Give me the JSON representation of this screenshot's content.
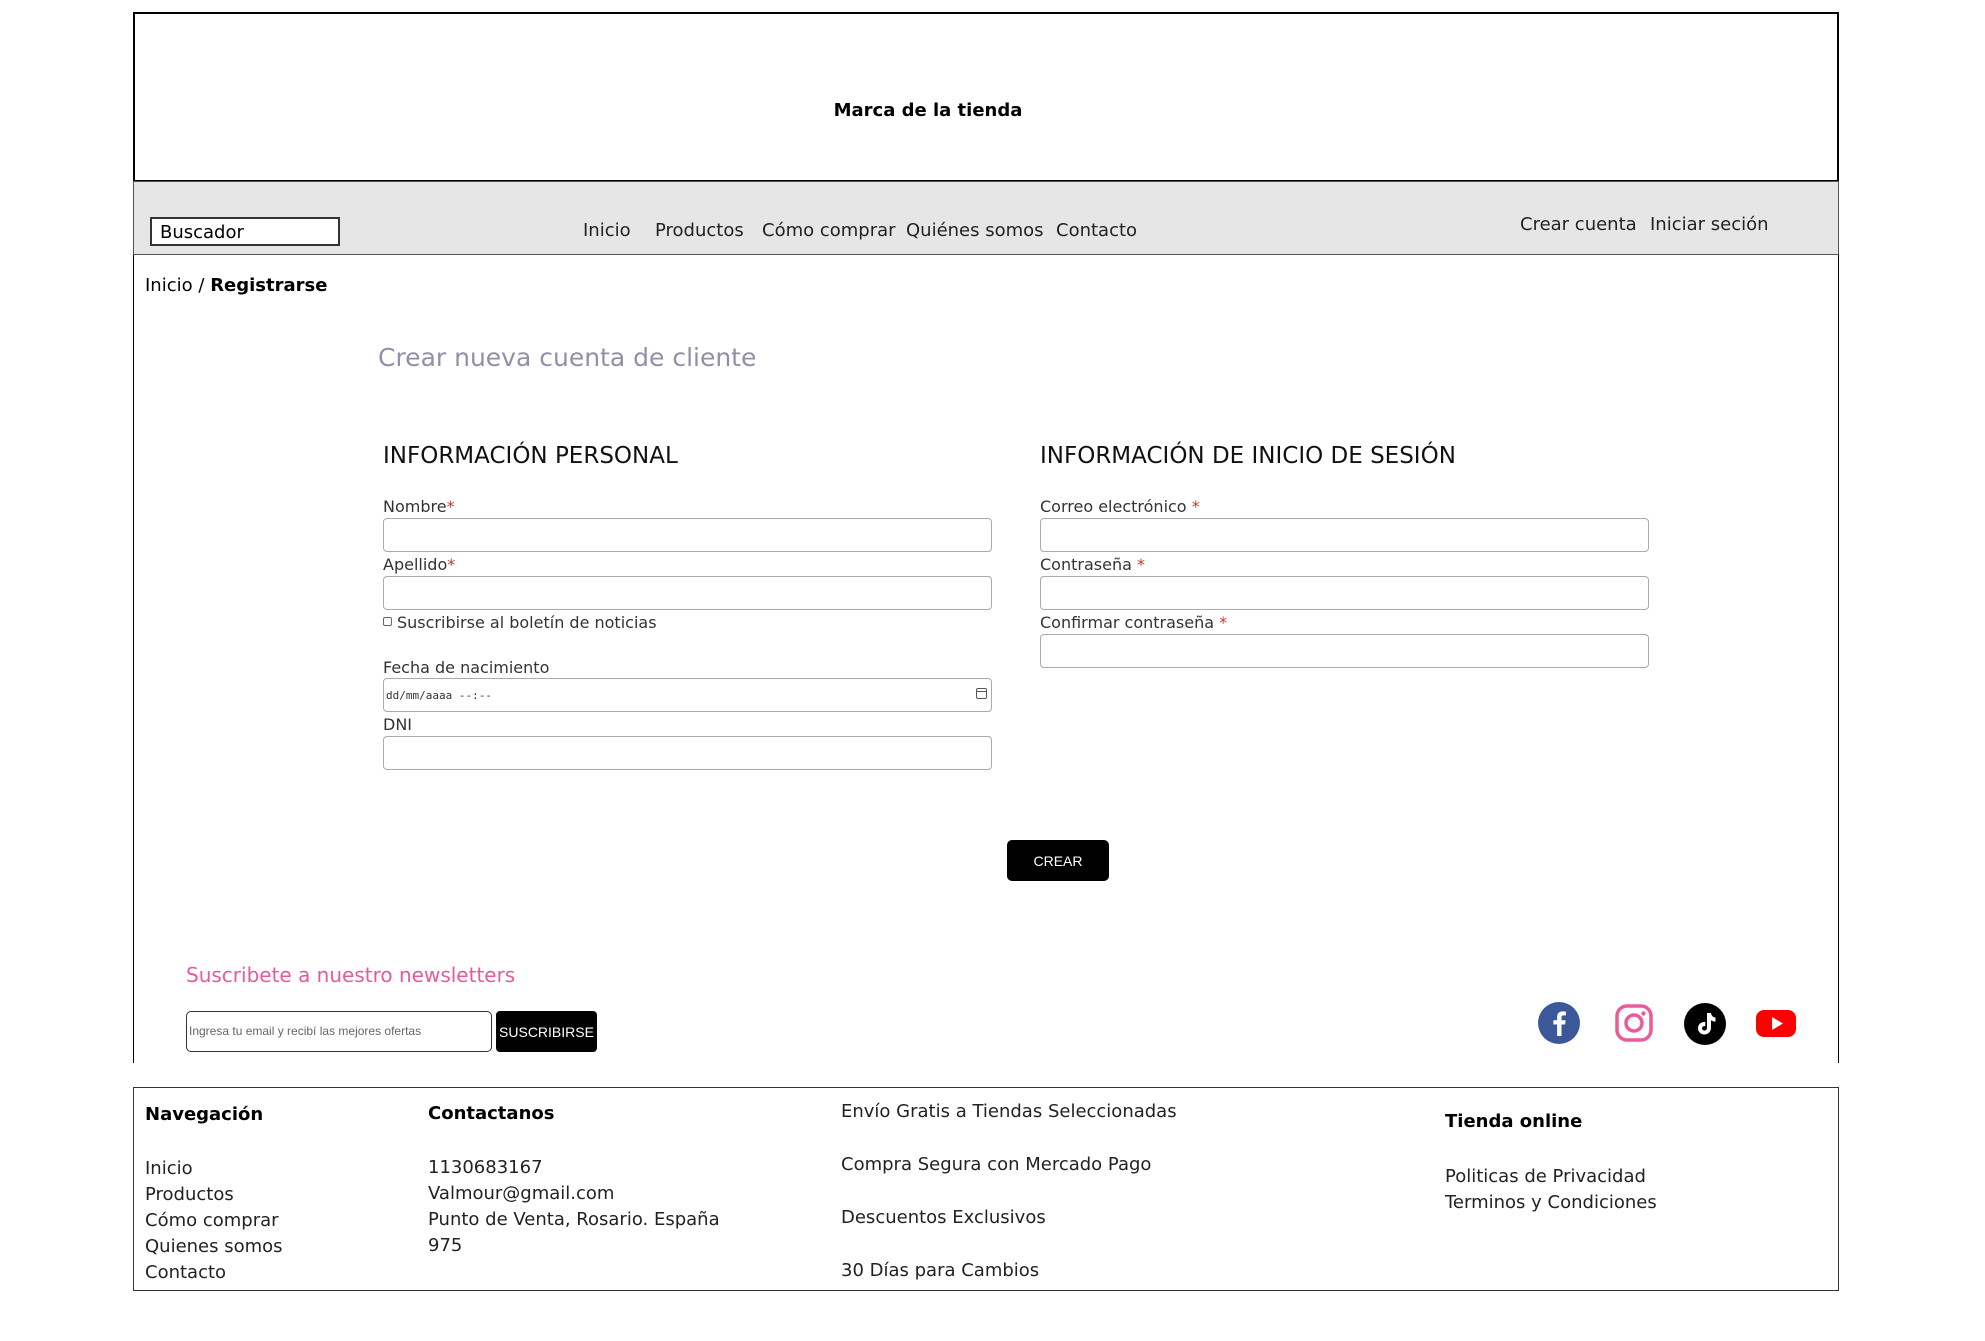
{
  "header": {
    "brand": "Marca de la tienda"
  },
  "navbar": {
    "search_placeholder": "Buscador",
    "links": [
      "Inicio",
      "Productos",
      "Cómo comprar",
      "Quiénes somos",
      "Contacto"
    ],
    "create_account": "Crear cuenta",
    "login": "Iniciar seción"
  },
  "breadcrumb": {
    "home": "Inicio",
    "separator": "/",
    "current": "Registrarse"
  },
  "form": {
    "title": "Crear nueva cuenta de cliente",
    "personal": {
      "heading": "INFORMACIÓN PERSONAL",
      "nombre": "Nombre",
      "apellido": "Apellido",
      "newsletter": "Suscribirse al boletín de noticias",
      "birthdate": "Fecha de nacimiento",
      "birthdate_placeholder": "dd/mm/aaaa --:--",
      "dni": "DNI"
    },
    "login": {
      "heading": "INFORMACIÓN DE INICIO DE SESIÓN",
      "email": "Correo electrónico",
      "password": "Contraseña",
      "confirm": "Confirmar contraseña"
    },
    "required_mark": "*",
    "submit": "CREAR"
  },
  "newsletter": {
    "title": "Suscribete a nuestro newsletters",
    "placeholder": "Ingresa tu email y recibí las mejores ofertas",
    "button": "SUSCRIBIRSE"
  },
  "social": {
    "icons": [
      "facebook-icon",
      "instagram-icon",
      "tiktok-icon",
      "youtube-icon"
    ],
    "colors": {
      "facebook": "#3b5998",
      "instagram": "#e95b9b",
      "tiktok": "#000000",
      "youtube": "#ff0000"
    }
  },
  "footer": {
    "nav_title": "Navegación",
    "nav_items": [
      "Inicio",
      "Productos",
      "Cómo comprar",
      "Quienes somos",
      "Contacto"
    ],
    "contact_title": "Contactanos",
    "contact_phone": "1130683167",
    "contact_email": "Valmour@gmail.com",
    "contact_address": "Punto de Venta, Rosario. España",
    "contact_number": "975",
    "benefits": [
      "Envío Gratis a Tiendas Seleccionadas",
      "Compra Segura con Mercado Pago",
      "Descuentos Exclusivos",
      "30 Días para Cambios"
    ],
    "store_title": "Tienda online",
    "privacy": "Politicas de Privacidad",
    "terms": "Terminos y Condiciones"
  },
  "colors": {
    "title_grey": "#9090a8",
    "newsletter_pink": "#e35b9e",
    "navbar_bg": "#e6e6e6"
  }
}
